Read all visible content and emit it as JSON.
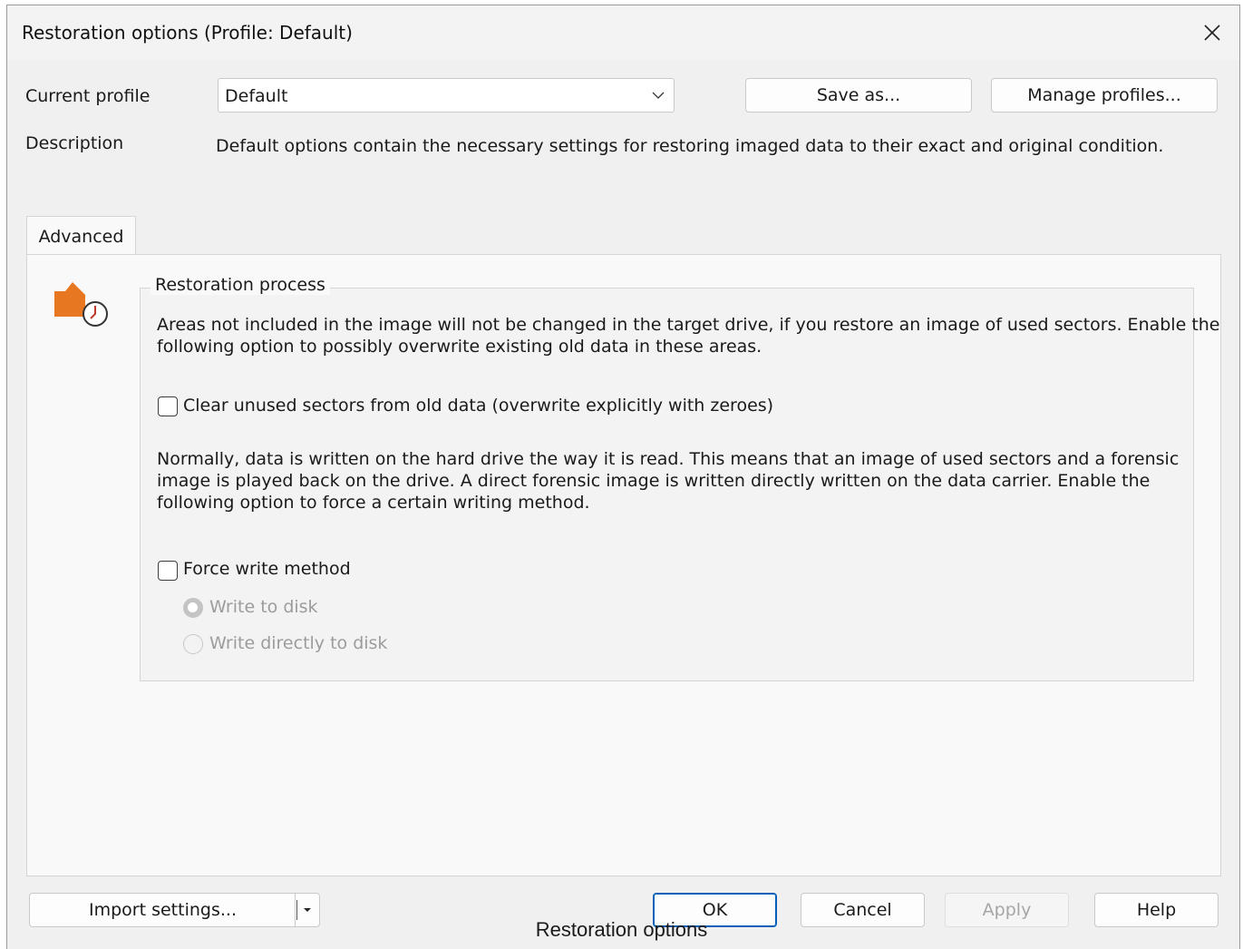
{
  "window": {
    "title": "Restoration options (Profile: Default)"
  },
  "profile": {
    "current_label": "Current profile",
    "current_value": "Default",
    "save_as_label": "Save as...",
    "manage_label": "Manage profiles...",
    "description_label": "Description",
    "description_text": "Default options contain the necessary settings for restoring imaged data to their exact and original condition."
  },
  "tabs": [
    {
      "label": "Advanced",
      "selected": true
    }
  ],
  "restoration": {
    "group_title": "Restoration process",
    "para1_line1": "Areas not included in the image will not be changed in the target drive, if you restore an image of used sectors. Enable the",
    "para1_line2": "following option to possibly overwrite existing old data in these areas.",
    "clear_unused_label": "Clear unused sectors from old data (overwrite explicitly with zeroes)",
    "clear_unused_checked": false,
    "para2_line1": "Normally, data is written on the hard drive the way it is read. This means that an image of used sectors and a forensic",
    "para2_line2": "image is played back on the drive. A direct forensic image is written directly written on the data carrier. Enable the",
    "para2_line3": "following option to force a certain writing method.",
    "force_write_label": "Force write method",
    "force_write_checked": false,
    "radio_write_to_disk": "Write to disk",
    "radio_write_directly": "Write directly to disk",
    "selected_radio": "Write to disk"
  },
  "footer": {
    "import_label": "Import settings...",
    "ok_label": "OK",
    "cancel_label": "Cancel",
    "apply_label": "Apply",
    "help_label": "Help"
  },
  "caption": "Restoration options",
  "colors": {
    "accent": "#005fb8",
    "icon_orange": "#e87722"
  }
}
